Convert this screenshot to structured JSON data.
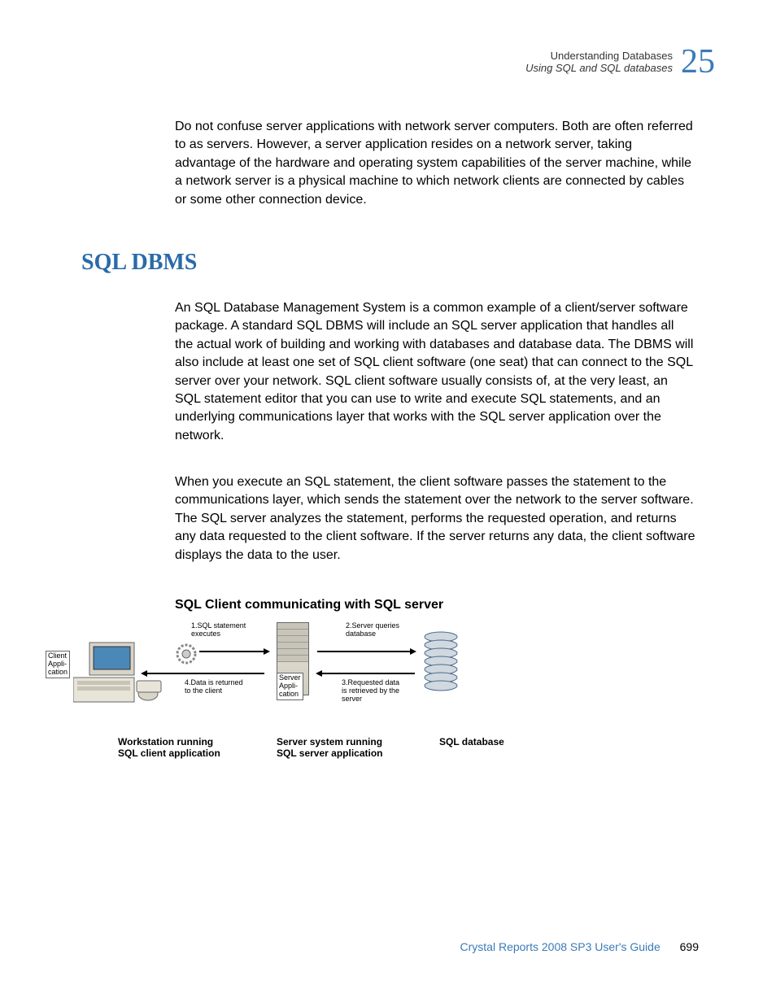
{
  "header": {
    "breadcrumb": "Understanding Databases",
    "section": "Using SQL and SQL databases",
    "chapter_number": "25"
  },
  "paragraphs": {
    "p1": "Do not confuse server applications with network server computers. Both are often referred to as servers. However, a server application resides on a network server, taking advantage of the hardware and operating system capabilities of the server machine, while a network server is a physical machine to which network clients are connected by cables or some other connection device.",
    "p2": "An SQL Database Management System is a common example of a client/server software package. A standard SQL DBMS will include an SQL server application that handles all the actual work of building and working with databases and database data. The DBMS will also include at least one set of SQL client software (one seat) that can connect to the SQL server over your network. SQL client software usually consists of, at the very least, an SQL statement editor that you can use to write and execute SQL statements, and an underlying communications layer that works with the SQL server application over the network.",
    "p3": "When you execute an SQL statement, the client software passes the statement to the communications layer, which sends the statement over the network to the server software. The SQL server analyzes the statement, performs the requested operation, and returns any data requested to the client software. If the server returns any data, the client software displays the data to the user."
  },
  "section_heading": "SQL DBMS",
  "figure": {
    "title": "SQL Client communicating with SQL server",
    "client_app_label": "Client\nAppli-\ncation",
    "server_app_label": "Server\nAppli-\ncation",
    "step1": "1.SQL statement\nexecutes",
    "step2": "2.Server queries\ndatabase",
    "step3": "3.Requested data\nis retrieved by the\nserver",
    "step4": "4.Data is returned\nto the client",
    "caption1": "Workstation running\nSQL client application",
    "caption2": "Server system running\nSQL server application",
    "caption3": "SQL database"
  },
  "footer": {
    "guide": "Crystal Reports 2008 SP3 User's Guide",
    "page": "699"
  }
}
